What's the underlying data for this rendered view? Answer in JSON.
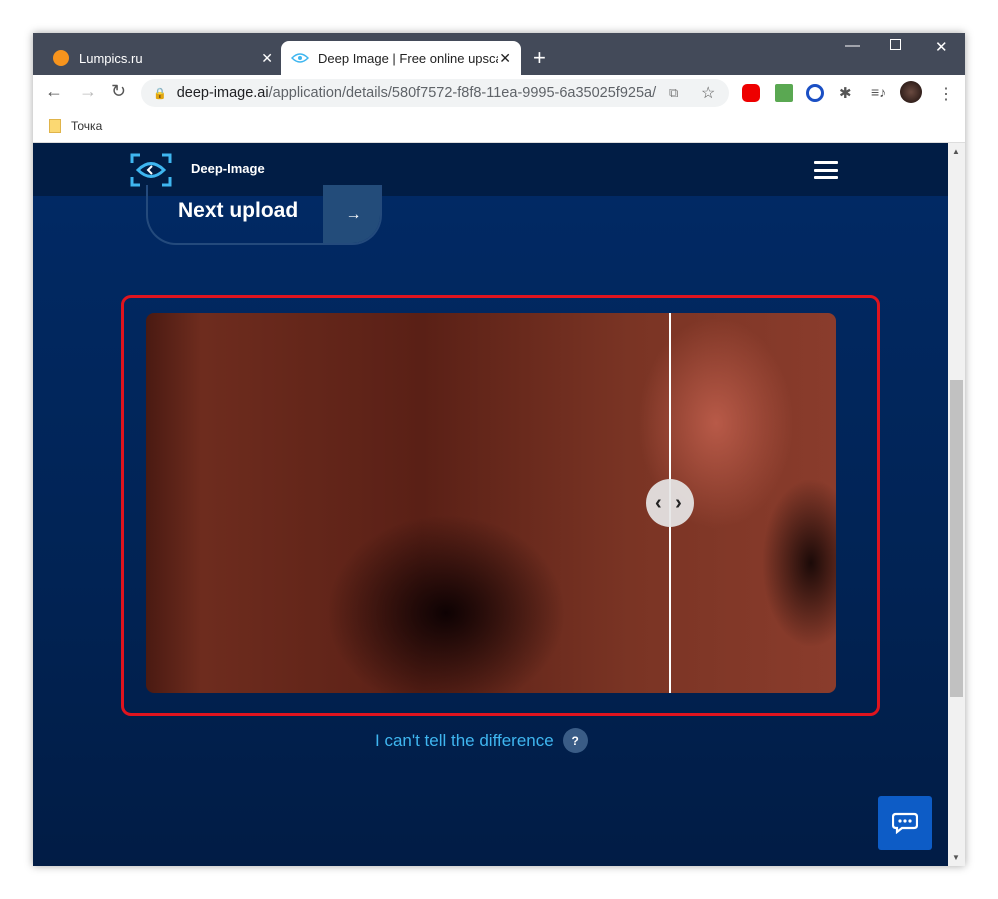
{
  "browser": {
    "tabs": [
      {
        "label": "Lumpics.ru",
        "icon": "orange-icon"
      },
      {
        "label": "Deep Image | Free online upscale",
        "icon": "eye-icon",
        "active": true
      }
    ],
    "url_domain": "deep-image.ai",
    "url_path": "/application/details/580f7572-f8f8-11ea-9995-6a35025f925a/",
    "bookmarks": [
      {
        "label": "Точка"
      }
    ]
  },
  "site": {
    "logo": "Deep-Image",
    "next_upload": "Next upload",
    "next_arrow": "→",
    "compare_handle": "‹ ›",
    "split_fraction": 0.76,
    "difference_link": "I can't tell the difference",
    "help": "?",
    "colors": {
      "accent": "#3fb6f0",
      "highlight": "#e0141e",
      "chat": "#0d5cc6"
    }
  }
}
